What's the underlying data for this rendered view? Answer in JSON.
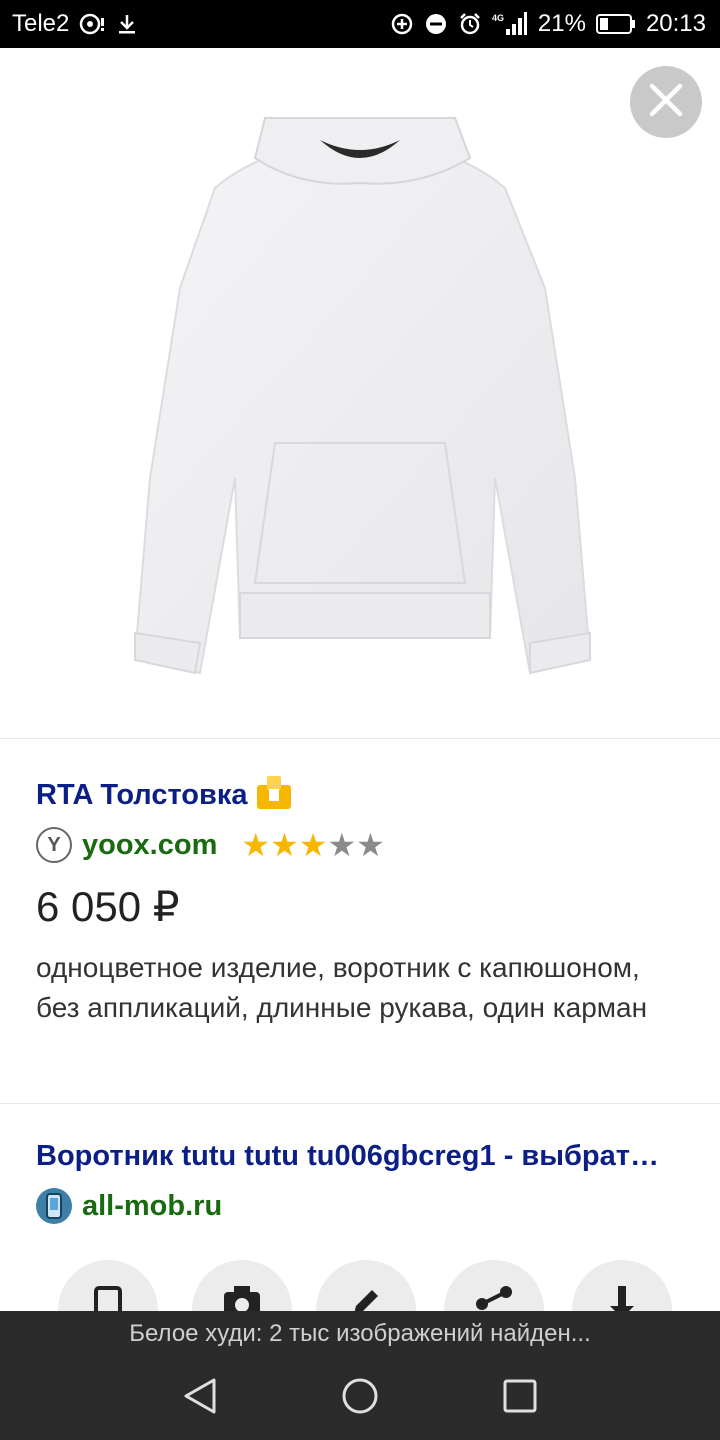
{
  "status_bar": {
    "carrier": "Tele2",
    "network": "4G",
    "battery_percent": "21%",
    "time": "20:13",
    "icons": [
      "hotspot-icon",
      "download-icon",
      "data-saver-icon",
      "do-not-disturb-icon",
      "alarm-icon",
      "signal-icon",
      "battery-icon"
    ]
  },
  "image_viewer": {
    "image_subject": "white-hoodie",
    "close_icon": "close-icon"
  },
  "result": {
    "title": "RTA Толстовка",
    "badge_icon": "shopping-bag-icon",
    "source": "yoox.com",
    "source_icon_letter": "Y",
    "rating": 3,
    "rating_max": 5,
    "price": "6 050 ₽",
    "description": "одноцветное изделие, воротник с капюшоном, без аппликаций, длинные рукава, один карман"
  },
  "second_result": {
    "title": "Воротник tutu tutu tu006gbcreg1 - выбрат…",
    "source": "all-mob.ru"
  },
  "actions": [
    "crop-icon",
    "camera-icon",
    "edit-icon",
    "share-icon",
    "download-icon"
  ],
  "caption": "Белое худи: 2 тыс изображений найден...",
  "navigation": {
    "back": "back-icon",
    "home": "home-icon",
    "recents": "recents-icon"
  },
  "colors": {
    "title_blue": "#0c1f87",
    "source_green": "#1a6a12",
    "star_gold": "#f7b600",
    "star_gray": "#8a8a8a",
    "caption_bg": "#2b2b2b"
  }
}
